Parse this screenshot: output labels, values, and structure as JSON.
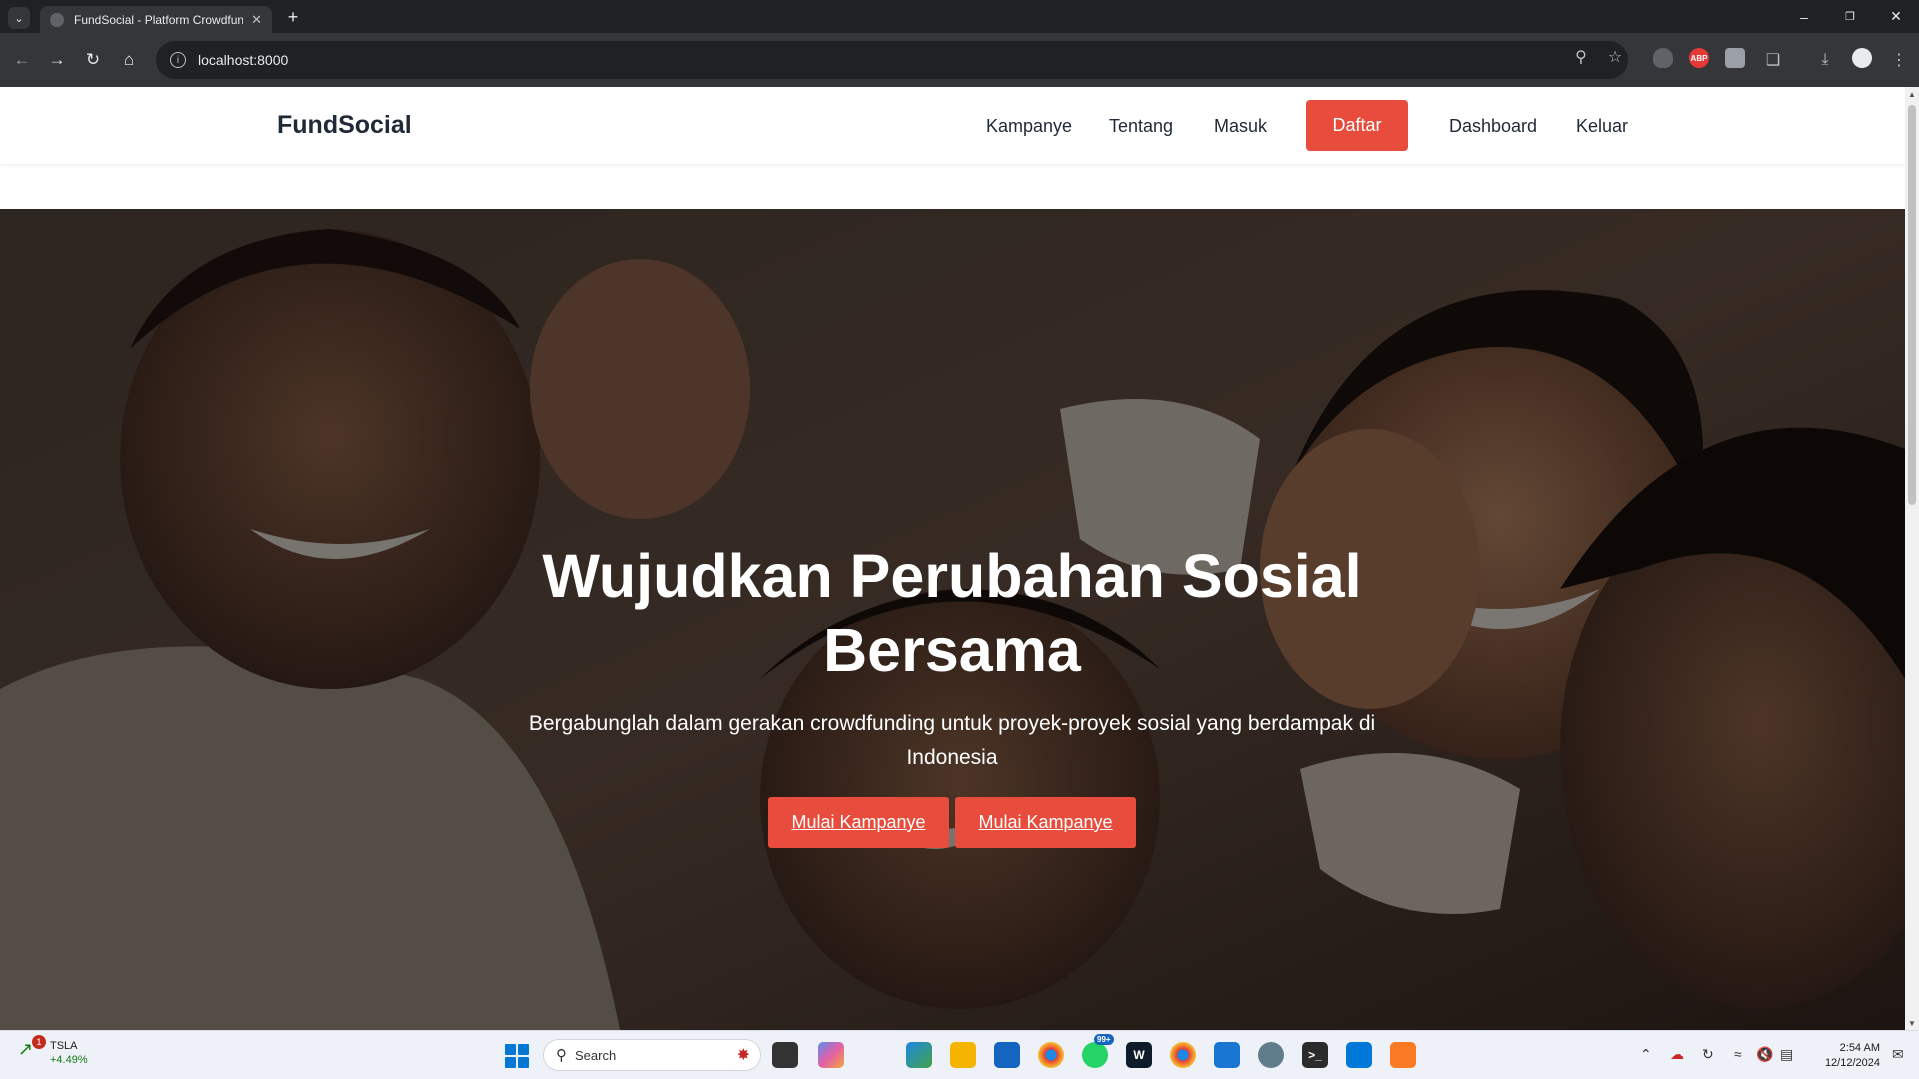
{
  "browser": {
    "tab_title": "FundSocial - Platform Crowdfun",
    "url": "localhost:8000",
    "badge_text": "ABP"
  },
  "site": {
    "brand": "FundSocial",
    "nav": [
      "Kampanye",
      "Tentang",
      "Masuk",
      "Daftar",
      "Dashboard",
      "Keluar"
    ]
  },
  "hero": {
    "title": "Wujudkan Perubahan Sosial Bersama",
    "subtitle": "Bergabunglah dalam gerakan crowdfunding untuk proyek-proyek sosial yang berdampak di Indonesia",
    "buttons": [
      "Mulai Kampanye",
      "Mulai Kampanye"
    ]
  },
  "taskbar": {
    "stock_name": "TSLA",
    "stock_change": "+4.49%",
    "stock_badge": "1",
    "search_placeholder": "Search",
    "notification_badge": "99+",
    "time": "2:54 AM",
    "date": "12/12/2024"
  },
  "colors": {
    "accent": "#e74c3c",
    "chrome_dark": "#202124",
    "chrome_toolbar": "#35363a"
  }
}
